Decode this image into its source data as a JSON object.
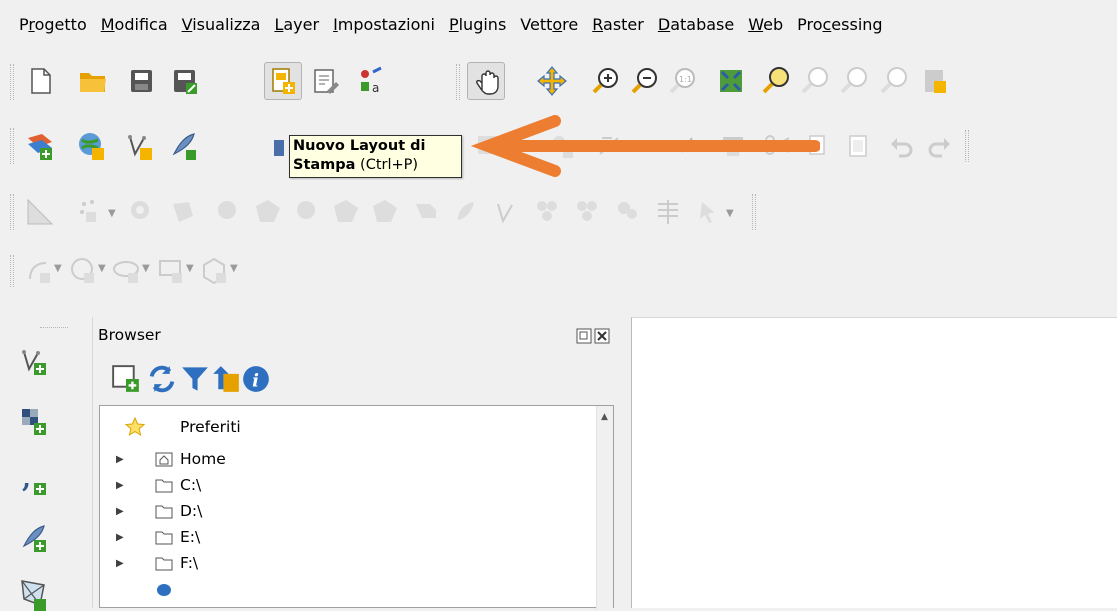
{
  "menubar": {
    "items": [
      {
        "pre": "P",
        "u": "r",
        "post": "ogetto"
      },
      {
        "pre": "",
        "u": "M",
        "post": "odifica"
      },
      {
        "pre": "",
        "u": "V",
        "post": "isualizza"
      },
      {
        "pre": "",
        "u": "L",
        "post": "ayer"
      },
      {
        "pre": "",
        "u": "I",
        "post": "mpostazioni"
      },
      {
        "pre": "",
        "u": "P",
        "post": "lugins"
      },
      {
        "pre": "Vett",
        "u": "o",
        "post": "re"
      },
      {
        "pre": "",
        "u": "R",
        "post": "aster"
      },
      {
        "pre": "",
        "u": "D",
        "post": "atabase"
      },
      {
        "pre": "",
        "u": "W",
        "post": "eb"
      },
      {
        "pre": "Pro",
        "u": "c",
        "post": "essing"
      }
    ]
  },
  "tooltip": {
    "bold": "Nuovo Layout di Stampa",
    "shortcut": "(Ctrl+P)"
  },
  "colors": {
    "arrow": "#ed7d31",
    "tooltip_bg": "#ffffe1",
    "accent_green": "#3a9a2a",
    "folder_yellow": "#f5b400"
  },
  "browser": {
    "title": "Browser",
    "items": [
      {
        "label": "Preferiti",
        "icon": "star-icon"
      },
      {
        "label": "Home",
        "icon": "home-folder-icon"
      },
      {
        "label": "C:\\",
        "icon": "folder-icon"
      },
      {
        "label": "D:\\",
        "icon": "folder-icon"
      },
      {
        "label": "E:\\",
        "icon": "folder-icon"
      },
      {
        "label": "F:\\",
        "icon": "folder-icon"
      }
    ]
  }
}
